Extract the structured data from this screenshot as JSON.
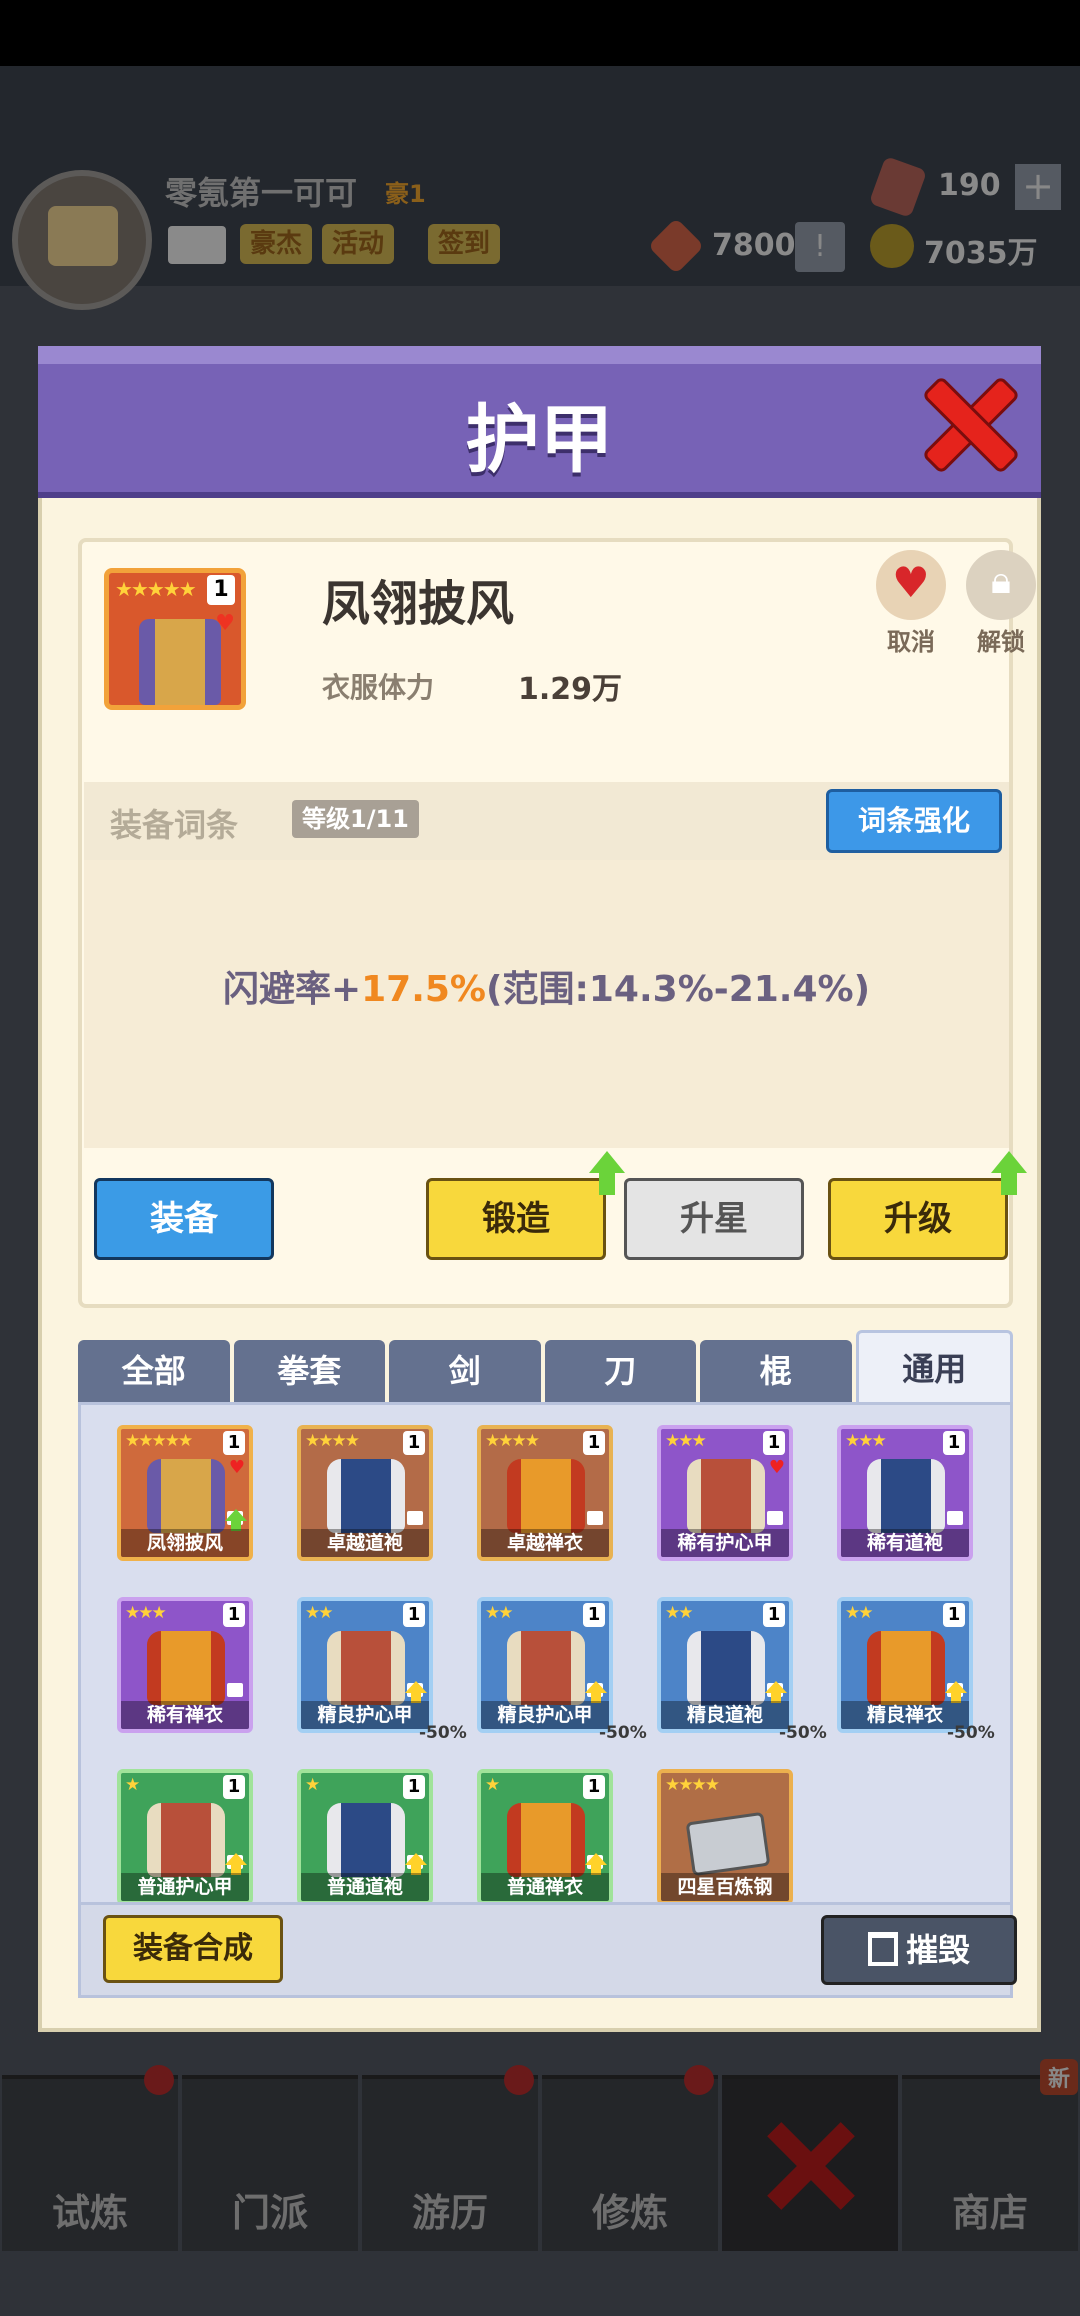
{
  "background": {
    "player": {
      "name": "零氪第一可可",
      "rank": "豪1"
    },
    "header_buttons": [
      "豪杰",
      "活动",
      "签到"
    ],
    "resources": {
      "gems": "190",
      "tokens": "7800",
      "gold": "7035万"
    },
    "plus_label": "+",
    "alert_label": "!",
    "nav": [
      {
        "label": "试炼"
      },
      {
        "label": "门派"
      },
      {
        "label": "游历"
      },
      {
        "label": "修炼"
      },
      {
        "label": ""
      },
      {
        "label": "商店"
      }
    ],
    "new_badge": "新"
  },
  "modal": {
    "title": "护甲",
    "item": {
      "name": "凤翎披风",
      "stars": "★★★★★",
      "level": "1",
      "stat_label": "衣服体力",
      "stat_value": "1.29万",
      "cancel_label": "取消",
      "unlock_label": "解锁"
    },
    "affix": {
      "title": "装备词条",
      "level": "等级1/11",
      "enhance_label": "词条强化",
      "effect_prefix": "闪避率+",
      "effect_value": "17.5%",
      "effect_range": "(范围:14.3%-21.4%)"
    },
    "actions": {
      "equip": "装备",
      "forge": "锻造",
      "star_up": "升星",
      "upgrade": "升级"
    },
    "tabs": [
      "全部",
      "拳套",
      "剑",
      "刀",
      "棍",
      "通用"
    ],
    "active_tab": "通用",
    "items": [
      {
        "name": "凤翎披风",
        "stars": "★★★★★",
        "level": "1"
      },
      {
        "name": "卓越道袍",
        "stars": "★★★★",
        "level": "1"
      },
      {
        "name": "卓越禅衣",
        "stars": "★★★★",
        "level": "1"
      },
      {
        "name": "稀有护心甲",
        "stars": "★★★",
        "level": "1"
      },
      {
        "name": "稀有道袍",
        "stars": "★★★",
        "level": "1"
      },
      {
        "name": "稀有禅衣",
        "stars": "★★★",
        "level": "1"
      },
      {
        "name": "精良护心甲",
        "stars": "★★",
        "level": "1",
        "discount": "-50%"
      },
      {
        "name": "精良护心甲",
        "stars": "★★",
        "level": "1",
        "discount": "-50%"
      },
      {
        "name": "精良道袍",
        "stars": "★★",
        "level": "1",
        "discount": "-50%"
      },
      {
        "name": "精良禅衣",
        "stars": "★★",
        "level": "1",
        "discount": "-50%"
      },
      {
        "name": "普通护心甲",
        "stars": "★",
        "level": "1"
      },
      {
        "name": "普通道袍",
        "stars": "★",
        "level": "1"
      },
      {
        "name": "普通禅衣",
        "stars": "★",
        "level": "1"
      },
      {
        "name": "四星百炼钢",
        "stars": "★★★★",
        "level": ""
      }
    ],
    "synthesize_label": "装备合成",
    "destroy_label": "摧毁"
  }
}
